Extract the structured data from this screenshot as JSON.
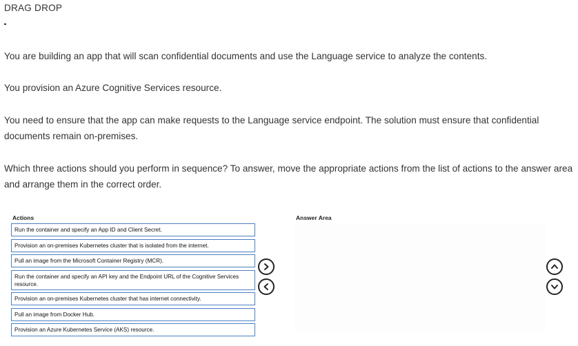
{
  "question": {
    "title": "DRAG DROP",
    "paragraphs": [
      "You are building an app that will scan confidential documents and use the Language service to analyze the contents.",
      "You provision an Azure Cognitive Services resource.",
      "You need to ensure that the app can make requests to the Language service endpoint. The solution must ensure that confidential documents remain on-premises.",
      "Which three actions should you perform in sequence? To answer, move the appropriate actions from the list of actions to the answer area and arrange them in the correct order."
    ]
  },
  "actions": {
    "label": "Actions",
    "items": [
      "Run the container and specify an App ID and Client Secret.",
      "Provision an on-premises Kubernetes cluster that is isolated from the internet.",
      "Pull an image from the Microsoft Container Registry (MCR).",
      "Run the container and specify an API key and the Endpoint URL of the Cognitive Services resource.",
      "Provision an on-premises Kubernetes cluster that has internet connectivity.",
      "Pull an image from Docker Hub.",
      "Provision an Azure Kubernetes Service (AKS) resource."
    ]
  },
  "answer_area": {
    "label": "Answer Area"
  },
  "icons": {
    "move_right": "chevron-right-icon",
    "move_left": "chevron-left-icon",
    "move_up": "chevron-up-icon",
    "move_down": "chevron-down-icon"
  }
}
